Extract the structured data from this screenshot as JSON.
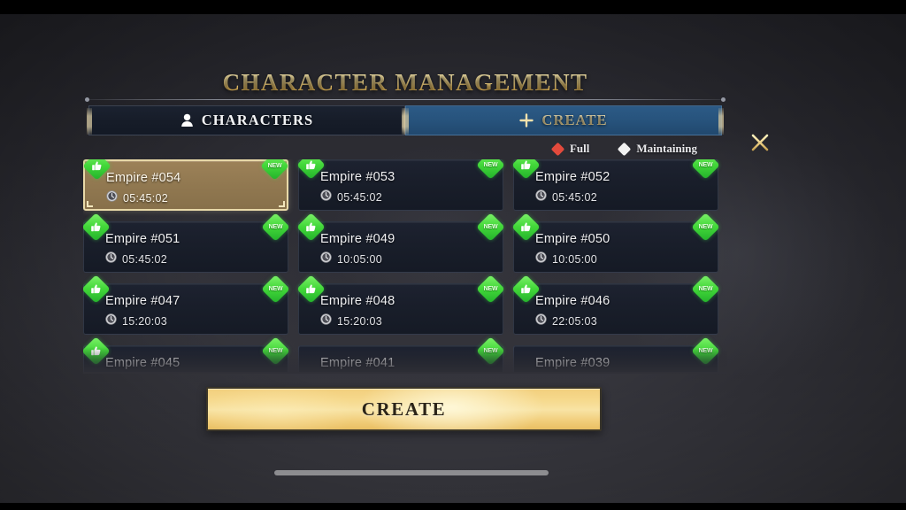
{
  "window": {
    "title": "CHARACTER MANAGEMENT",
    "close_icon": "close-x-icon"
  },
  "tabs": [
    {
      "label": "CHARACTERS",
      "icon": "person-icon",
      "active": false
    },
    {
      "label": "CREATE",
      "icon": "plus-icon",
      "active": true
    }
  ],
  "legend": [
    {
      "label": "Full",
      "color": "#e34a3c",
      "icon": "diamond-icon"
    },
    {
      "label": "Maintaining",
      "color": "#f2f2f2",
      "icon": "diamond-icon"
    }
  ],
  "cards": [
    {
      "name": "Empire #054",
      "time": "05:45:02",
      "selected": true,
      "like": true,
      "new": true
    },
    {
      "name": "Empire #053",
      "time": "05:45:02",
      "selected": false,
      "like": true,
      "new": true
    },
    {
      "name": "Empire #052",
      "time": "05:45:02",
      "selected": false,
      "like": true,
      "new": true
    },
    {
      "name": "Empire #051",
      "time": "05:45:02",
      "selected": false,
      "like": true,
      "new": true
    },
    {
      "name": "Empire #049",
      "time": "10:05:00",
      "selected": false,
      "like": true,
      "new": true
    },
    {
      "name": "Empire #050",
      "time": "10:05:00",
      "selected": false,
      "like": true,
      "new": true
    },
    {
      "name": "Empire #047",
      "time": "15:20:03",
      "selected": false,
      "like": true,
      "new": true
    },
    {
      "name": "Empire #048",
      "time": "15:20:03",
      "selected": false,
      "like": true,
      "new": true
    },
    {
      "name": "Empire #046",
      "time": "22:05:03",
      "selected": false,
      "like": true,
      "new": true
    },
    {
      "name": "Empire #045",
      "time": "",
      "selected": false,
      "like": true,
      "new": true
    },
    {
      "name": "Empire #041",
      "time": "",
      "selected": false,
      "like": false,
      "new": true
    },
    {
      "name": "Empire #039",
      "time": "",
      "selected": false,
      "like": false,
      "new": true
    }
  ],
  "badges": {
    "new_label": "NEW",
    "like_icon": "thumbs-up-icon",
    "clock_icon": "clock-icon",
    "badge_color": "#43d83a"
  },
  "footer": {
    "create_label": "CREATE"
  },
  "colors": {
    "gold": "#f0d48a",
    "accent_blue": "#27537c",
    "selected_card": "#937a52"
  }
}
